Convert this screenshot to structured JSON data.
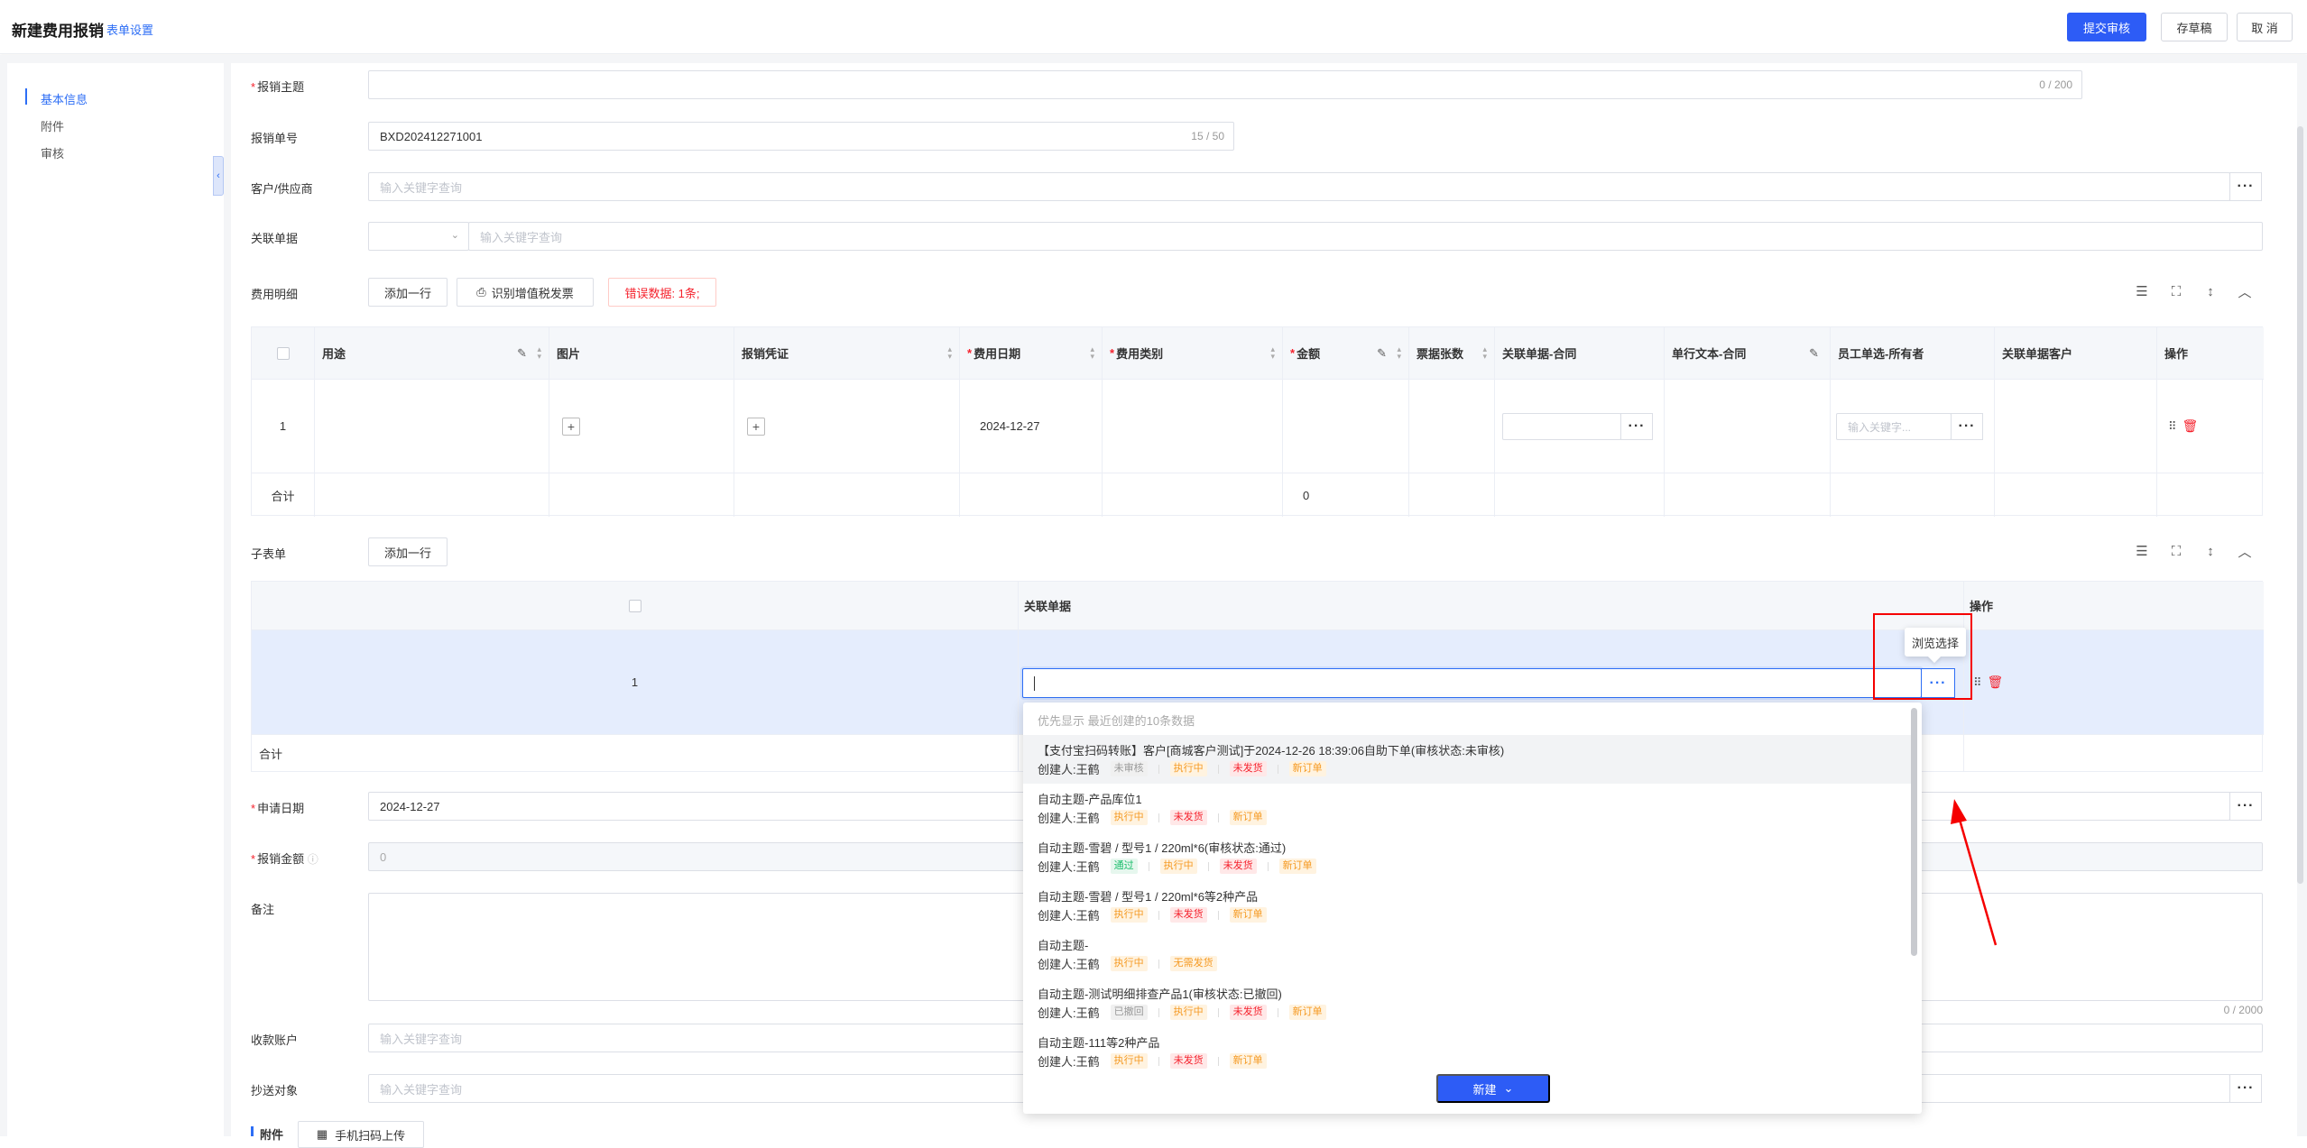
{
  "header": {
    "title": "新建费用报销",
    "form_settings": "表单设置",
    "submit": "提交审核",
    "save_draft": "存草稿",
    "cancel": "取 消"
  },
  "sidebar": {
    "items": [
      {
        "label": "基本信息",
        "active": true
      },
      {
        "label": "附件",
        "active": false
      },
      {
        "label": "审核",
        "active": false
      }
    ]
  },
  "form": {
    "subject": {
      "label": "报销主题",
      "value": "",
      "count": "0 / 200"
    },
    "order_no": {
      "label": "报销单号",
      "value": "BXD202412271001",
      "count": "15 / 50"
    },
    "customer": {
      "label": "客户/供应商",
      "placeholder": "输入关键字查询"
    },
    "related": {
      "label": "关联单据",
      "placeholder": "输入关键字查询"
    },
    "apply_date": {
      "label": "申请日期",
      "value": "2024-12-27"
    },
    "amount": {
      "label": "报销金额",
      "value": "0"
    },
    "remark": {
      "label": "备注",
      "count": "0 / 2000"
    },
    "account": {
      "label": "收款账户",
      "placeholder": "输入关键字查询"
    },
    "cc": {
      "label": "抄送对象",
      "placeholder": "输入关键字查询"
    },
    "attachment": {
      "label": "附件",
      "scan_upload": "手机扫码上传"
    }
  },
  "expense": {
    "label": "费用明细",
    "add_row": "添加一行",
    "recognize_invoice": "识别增值税发票",
    "error_data": "错误数据: 1条;",
    "columns": [
      "用途",
      "图片",
      "报销凭证",
      "费用日期",
      "费用类别",
      "金额",
      "票据张数",
      "关联单据-合同",
      "单行文本-合同",
      "员工单选-所有者",
      "关联单据客户",
      "操作"
    ],
    "required_columns": [
      "费用日期",
      "费用类别",
      "金额"
    ],
    "row": {
      "index": "1",
      "date": "2024-12-27",
      "employee_placeholder": "输入关键字..."
    },
    "total_label": "合计",
    "total_amount": "0"
  },
  "subform": {
    "label": "子表单",
    "add_row": "添加一行",
    "columns": [
      "关联单据",
      "操作"
    ],
    "row_index": "1",
    "total_label": "合计",
    "tooltip": "浏览选择"
  },
  "dropdown": {
    "hint": "优先显示 最近创建的10条数据",
    "new_button": "新建",
    "items": [
      {
        "title": "【支付宝扫码转账】客户[商城客户测试]于2024-12-26 18:39:06自助下单(审核状态:未审核)",
        "creator": "创建人:王鹤",
        "tags": [
          {
            "text": "未审核",
            "tone": "gray"
          },
          {
            "text": "执行中",
            "tone": "orange"
          },
          {
            "text": "未发货",
            "tone": "red"
          },
          {
            "text": "新订单",
            "tone": "orange"
          }
        ]
      },
      {
        "title": "自动主题-产品库位1",
        "creator": "创建人:王鹤",
        "tags": [
          {
            "text": "执行中",
            "tone": "orange"
          },
          {
            "text": "未发货",
            "tone": "red"
          },
          {
            "text": "新订单",
            "tone": "orange"
          }
        ]
      },
      {
        "title": "自动主题-雪碧 / 型号1 / 220ml*6(审核状态:通过)",
        "creator": "创建人:王鹤",
        "tags": [
          {
            "text": "通过",
            "tone": "green"
          },
          {
            "text": "执行中",
            "tone": "orange"
          },
          {
            "text": "未发货",
            "tone": "red"
          },
          {
            "text": "新订单",
            "tone": "orange"
          }
        ]
      },
      {
        "title": "自动主题-雪碧 / 型号1 / 220ml*6等2种产品",
        "creator": "创建人:王鹤",
        "tags": [
          {
            "text": "执行中",
            "tone": "orange"
          },
          {
            "text": "未发货",
            "tone": "red"
          },
          {
            "text": "新订单",
            "tone": "orange"
          }
        ]
      },
      {
        "title": "自动主题-",
        "creator": "创建人:王鹤",
        "tags": [
          {
            "text": "执行中",
            "tone": "orange"
          },
          {
            "text": "无需发货",
            "tone": "orange"
          }
        ]
      },
      {
        "title": "自动主题-测试明细排查产品1(审核状态:已撤回)",
        "creator": "创建人:王鹤",
        "tags": [
          {
            "text": "已撤回",
            "tone": "gray"
          },
          {
            "text": "执行中",
            "tone": "orange"
          },
          {
            "text": "未发货",
            "tone": "red"
          },
          {
            "text": "新订单",
            "tone": "orange"
          }
        ]
      },
      {
        "title": "自动主题-111等2种产品",
        "creator": "创建人:王鹤",
        "tags": [
          {
            "text": "执行中",
            "tone": "orange"
          },
          {
            "text": "未发货",
            "tone": "red"
          },
          {
            "text": "新订单",
            "tone": "orange"
          }
        ]
      }
    ]
  },
  "colors": {
    "primary": "#2d5cf6",
    "danger": "#f5222d",
    "annotation": "#f50000"
  },
  "icons": [
    "chevron-left-icon",
    "chevron-down-icon",
    "more-dots-icon",
    "edit-icon",
    "sort-icon",
    "plus-icon",
    "drag-icon",
    "delete-icon",
    "invoice-scan-icon",
    "column-settings-icon",
    "fullscreen-icon",
    "row-height-icon",
    "chevron-up-icon",
    "help-icon",
    "qr-code-icon"
  ]
}
